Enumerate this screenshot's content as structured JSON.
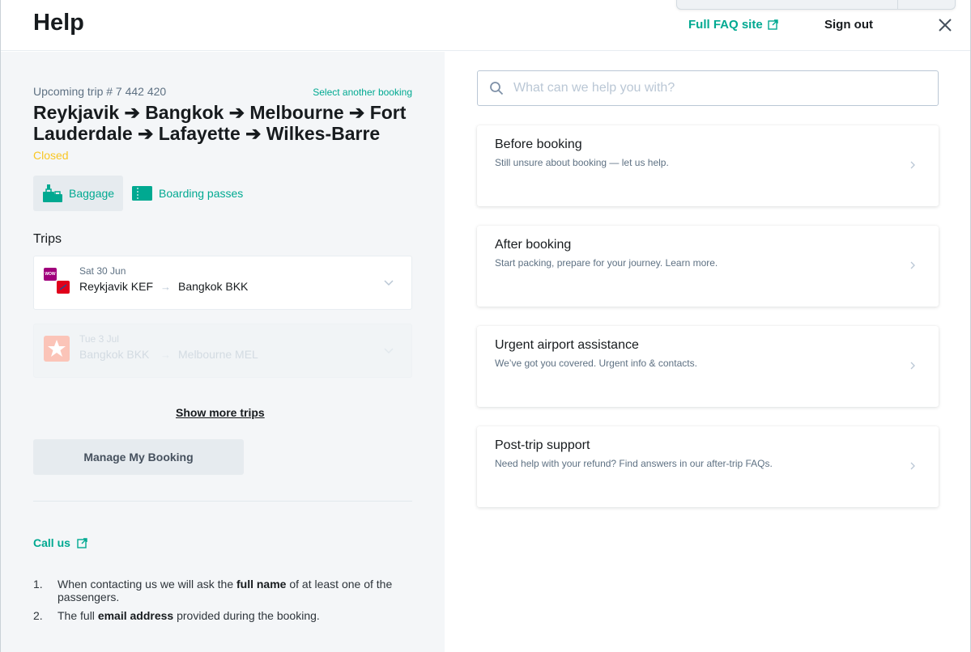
{
  "header": {
    "title": "Help",
    "faq_link": "Full FAQ site",
    "sign_out": "Sign out"
  },
  "booking": {
    "trip_number": "Upcoming trip # 7 442 420",
    "select_another": "Select another booking",
    "route": "Reykjavik ➔ Bangkok ➔ Melbourne ➔ Fort Lauderdale ➔ Lafayette ➔ Wilkes-Barre",
    "status": "Closed",
    "status_color": "#f9c623",
    "baggage_label": "Baggage",
    "boarding_label": "Boarding passes"
  },
  "trips": {
    "label": "Trips",
    "items": [
      {
        "date": "Sat 30 Jun",
        "from": "Reykjavik KEF",
        "to": "Bangkok BKK",
        "faded": false
      },
      {
        "date": "Tue 3 Jul",
        "from": "Bangkok BKK",
        "to": "Melbourne MEL",
        "faded": true
      }
    ],
    "arrow": "→",
    "show_more": "Show more trips",
    "manage_button": "Manage My Booking"
  },
  "contact": {
    "call_us": "Call us",
    "items": [
      {
        "num": "1.",
        "pre": "When contacting us we will ask the ",
        "bold": "full name",
        "post": " of at least one of the passengers."
      },
      {
        "num": "2.",
        "pre": "The full ",
        "bold": "email address",
        "post": " provided during the booking."
      }
    ]
  },
  "search": {
    "placeholder": "What can we help you with?"
  },
  "topics": [
    {
      "title": "Before booking",
      "desc": "Still unsure about booking — let us help."
    },
    {
      "title": "After booking",
      "desc": "Start packing, prepare for your journey. Learn more."
    },
    {
      "title": "Urgent airport assistance",
      "desc": "We’ve got you covered. Urgent info & contacts."
    },
    {
      "title": "Post-trip support",
      "desc": "Need help with your refund? Find answers in our after-trip FAQs."
    }
  ],
  "colors": {
    "accent": "#00a991",
    "text": "#171b1e",
    "secondary": "#5e7183",
    "panel": "#f4f6f8"
  },
  "icons": {
    "external": "external-link-icon",
    "close": "close-icon",
    "search": "search-icon",
    "baggage": "baggage-icon",
    "boarding": "boarding-pass-icon",
    "chevron": "chevron-right-icon"
  }
}
